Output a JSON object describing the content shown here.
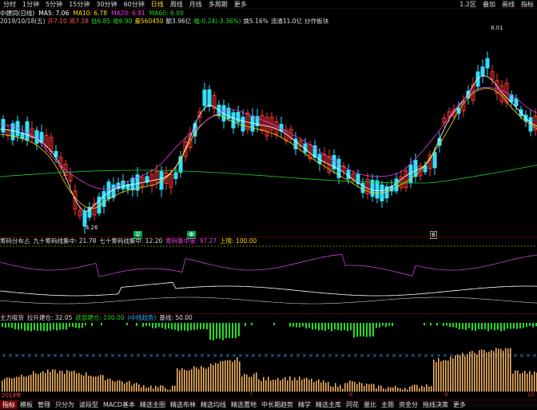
{
  "toolbar": {
    "items": [
      "分时",
      "1分钟",
      "5分钟",
      "15分钟",
      "30分钟",
      "60分钟",
      "日线",
      "周线",
      "月线",
      "多周期",
      "更多"
    ],
    "active_index": 6,
    "right_items": [
      "1.2区",
      "叠加",
      "画线",
      "指标"
    ]
  },
  "info1": {
    "name": "中建同(日线)",
    "ma5": "MA5: 7.06",
    "ma10": "MA10: 6.78",
    "ma20": "MA20: 6.81",
    "ma60": "MA60: 6.09"
  },
  "info2": {
    "date": "2019/10/18(五)",
    "open": "开7.10",
    "high": "高7.18",
    "low": "低6.85",
    "close": "收6.90",
    "volume": "量560450",
    "amount": "额3.96亿",
    "change": "幅-0.24(-3.36%)",
    "turnover": "换5.16%",
    "float": "流通11.0亿",
    "extra": "炒作板块"
  },
  "price_labels": {
    "high": "8.01",
    "low": "4.26"
  },
  "ind1": {
    "title": "筹码分布占",
    "v1": "九十筹码线集中: 21.78",
    "v2": "七十筹码线集中: 12.20",
    "v3": "筹码集中度: 97.27",
    "v4": "上限: 100.00"
  },
  "ind2": {
    "title": "主力吸货",
    "v1": "拉升建仓: 32.05",
    "v2": "底部建仓: 100.00",
    "v3": "(中线趋势)",
    "v4": "基线: 50.00"
  },
  "signals": [
    "买",
    "卖",
    "买",
    "B"
  ],
  "xaxis": [
    "2019年",
    "7",
    "8",
    "9",
    "10"
  ],
  "bottombar": {
    "items": [
      "指标",
      "模板",
      "管理",
      "只分为",
      "波段型",
      "MACD基本",
      "精选主图",
      "精选布林",
      "精选均线",
      "精选置地",
      "中长期趋势",
      "精学",
      "精选主库",
      "同花",
      "量比",
      "主题",
      "资金分",
      "拖线决策",
      "更多"
    ],
    "active_index": 0
  },
  "colors": {
    "up": "#ff3333",
    "down": "#33e0ff",
    "ma5": "#ffffff",
    "ma10": "#ffd700",
    "ma20": "#e040e0",
    "ma60": "#22cc22",
    "bg": "#000000"
  }
}
